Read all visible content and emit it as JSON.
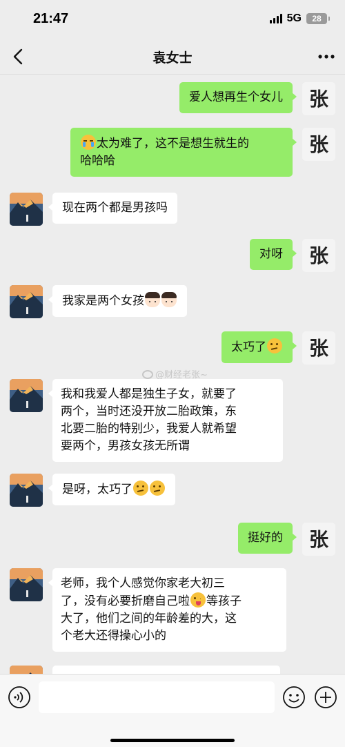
{
  "status_bar": {
    "time": "21:47",
    "network": "5G",
    "battery": "28"
  },
  "header": {
    "title": "袁女士"
  },
  "messages": [
    {
      "sender": "me",
      "text": "爱人想再生个女儿"
    },
    {
      "sender": "me",
      "lines": [
        "太为难了，这不是想生就生的",
        "哈哈哈"
      ],
      "emoji": "cry-icon"
    },
    {
      "sender": "other",
      "text": "现在两个都是男孩吗"
    },
    {
      "sender": "me",
      "text": "对呀"
    },
    {
      "sender": "other",
      "text": "我家是两个女孩",
      "emoji": "girl-icon"
    },
    {
      "sender": "me",
      "text": "太巧了",
      "emoji": "thinking-face-icon"
    },
    {
      "sender": "other",
      "lines": [
        "我和我爱人都是独生子女，就要了",
        "两个，当时还没开放二胎政策，东",
        "北要二胎的特别少，我爱人就希望",
        "要两个，男孩女孩无所谓"
      ]
    },
    {
      "sender": "other",
      "text": "是呀，太巧了",
      "emoji": "thinking-face-icon"
    },
    {
      "sender": "me",
      "text": "挺好的"
    },
    {
      "sender": "other",
      "lines": [
        "老师，我个人感觉你家老大初三",
        "了，没有必要折磨自己啦",
        "等孩子",
        "大了，他们之间的年龄差的大，这",
        "个老大还得操心小的"
      ],
      "emoji": "wink-icon"
    }
  ],
  "watermark": "@财经老张~",
  "avatars": {
    "mine": "张",
    "other": "mountain-sunset-avatar"
  },
  "input": {
    "value": ""
  },
  "colors": {
    "mine_bubble": "#95ec69",
    "other_bubble": "#ffffff",
    "background": "#ededed"
  }
}
